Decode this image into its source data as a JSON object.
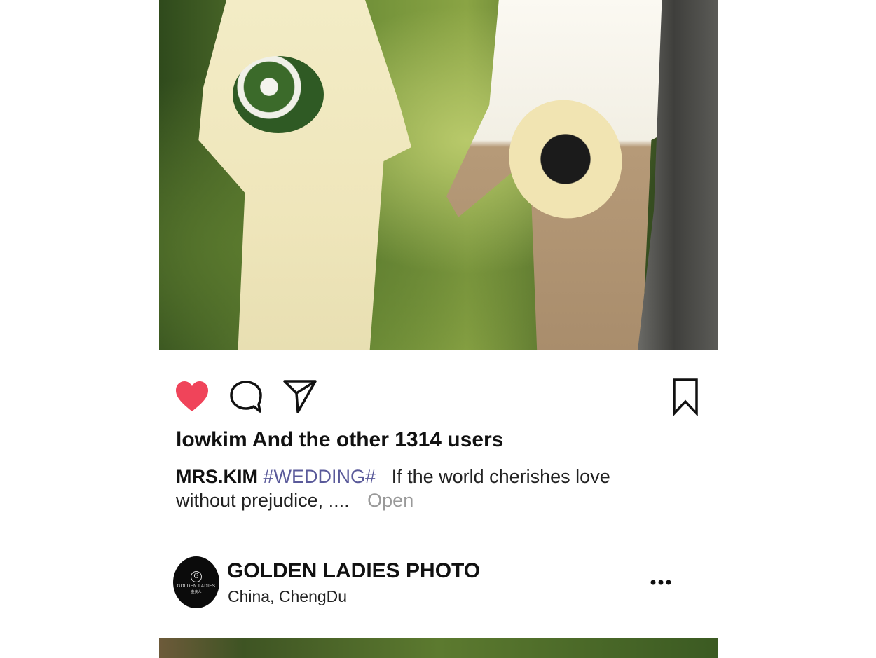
{
  "post": {
    "likes_text": "lowkim And the other 1314 users",
    "caption": {
      "username": "MRS.KIM",
      "hashtag": "#WEDDING#",
      "text": "If the world cherishes love without prejudice, ....",
      "more_label": "Open"
    },
    "liked": true
  },
  "account": {
    "avatar_brand": "GOLDEN LADIES",
    "avatar_monogram": "G",
    "avatar_subtext": "金夫人",
    "name": "GOLDEN LADIES PHOTO",
    "location": "China,  ChengDu"
  },
  "icons": {
    "like": "heart-icon",
    "comment": "comment-icon",
    "share": "send-icon",
    "save": "bookmark-icon",
    "more": "more-dots-icon"
  },
  "colors": {
    "like_red": "#f0445a",
    "hashtag": "#5a5a9a",
    "muted": "#999999"
  }
}
